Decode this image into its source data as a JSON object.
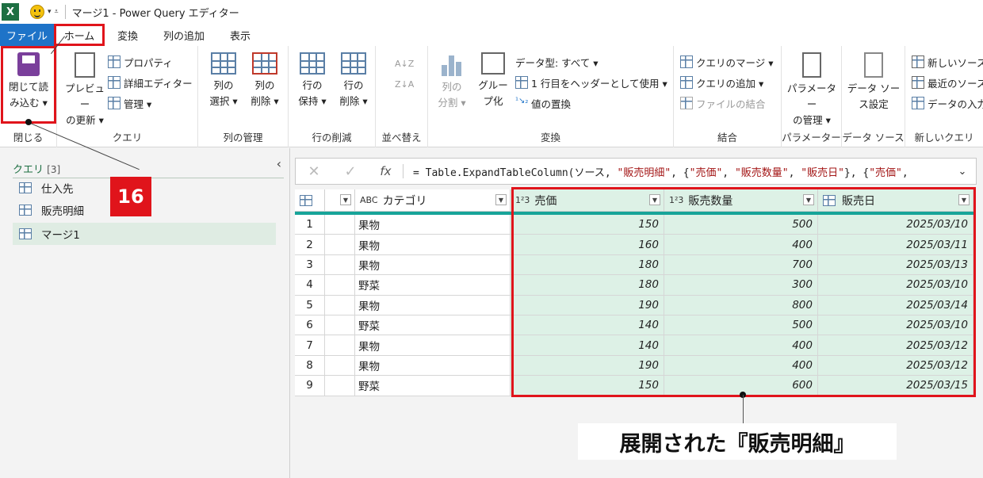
{
  "titlebar": {
    "app_icon": "X",
    "title": "マージ1 - Power Query エディター"
  },
  "tabs": [
    "ファイル",
    "ホーム",
    "変換",
    "列の追加",
    "表示"
  ],
  "ribbon": {
    "close": {
      "label1": "閉じて読",
      "label2": "み込む ▾",
      "group": "閉じる"
    },
    "query": {
      "preview1": "プレビュー",
      "preview2": "の更新 ▾",
      "props": "プロパティ",
      "advanced": "詳細エディター",
      "manage": "管理 ▾",
      "group": "クエリ"
    },
    "columns": {
      "select1": "列の",
      "select2": "選択 ▾",
      "remove1": "列の",
      "remove2": "削除 ▾",
      "group": "列の管理"
    },
    "rows": {
      "keep1": "行の",
      "keep2": "保持 ▾",
      "remove1": "行の",
      "remove2": "削除 ▾",
      "group": "行の削減"
    },
    "sort": {
      "group": "並べ替え"
    },
    "transform": {
      "split1": "列の",
      "split2": "分割 ▾",
      "group1": "グルー",
      "group2": "プ化",
      "dtype": "データ型: すべて ▾",
      "header": "1 行目をヘッダーとして使用 ▾",
      "replace": "値の置換",
      "group": "変換"
    },
    "combine": {
      "merge": "クエリのマージ ▾",
      "append": "クエリの追加 ▾",
      "files": "ファイルの結合",
      "group": "結合"
    },
    "params": {
      "manage1": "パラメーター",
      "manage2": "の管理 ▾",
      "group": "パラメーター"
    },
    "datasource": {
      "settings1": "データ ソー",
      "settings2": "ス設定",
      "group": "データ ソース"
    },
    "newquery": {
      "new_source": "新しいソース",
      "recent": "最近のソース",
      "enter": "データの入力",
      "group": "新しいクエリ"
    }
  },
  "queries": {
    "header": "クエリ",
    "count": "[3]",
    "items": [
      "仕入先",
      "販売明細",
      "マージ1"
    ]
  },
  "callout": "16",
  "formula": {
    "fx": "fx",
    "prefix": "= Table.ExpandTableColumn(ソース, ",
    "s1": "\"販売明細\"",
    "mid": ", {",
    "s2": "\"売価\"",
    "c1": ", ",
    "s3": "\"販売数量\"",
    "c2": ", ",
    "s4": "\"販売日\"",
    "end": "}, {",
    "s5": "\"売価\"",
    "tail": ","
  },
  "table": {
    "columns": [
      {
        "type": "ABC",
        "name": "カテゴリ"
      },
      {
        "type": "1²3",
        "name": "売価"
      },
      {
        "type": "1²3",
        "name": "販売数量"
      },
      {
        "type": "cal",
        "name": "販売日"
      }
    ],
    "rows": [
      [
        "1",
        "果物",
        "150",
        "500",
        "2025/03/10"
      ],
      [
        "2",
        "果物",
        "160",
        "400",
        "2025/03/11"
      ],
      [
        "3",
        "果物",
        "180",
        "700",
        "2025/03/13"
      ],
      [
        "4",
        "野菜",
        "180",
        "300",
        "2025/03/10"
      ],
      [
        "5",
        "果物",
        "190",
        "800",
        "2025/03/14"
      ],
      [
        "6",
        "野菜",
        "140",
        "500",
        "2025/03/10"
      ],
      [
        "7",
        "果物",
        "140",
        "400",
        "2025/03/12"
      ],
      [
        "8",
        "果物",
        "190",
        "400",
        "2025/03/12"
      ],
      [
        "9",
        "野菜",
        "150",
        "600",
        "2025/03/15"
      ]
    ]
  },
  "caption": "展開された『販売明細』"
}
